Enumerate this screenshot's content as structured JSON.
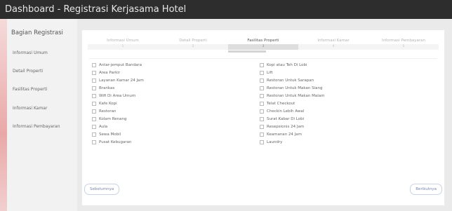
{
  "app": {
    "title": "Dashboard - Registrasi Kerjasama Hotel"
  },
  "colors": {
    "topbar": "#2d2d2d",
    "accent": "#e9a8a8",
    "panel": "#ffffff"
  },
  "sidebar": {
    "title": "Bagian Registrasi",
    "items": [
      {
        "label": "Informasi Umum"
      },
      {
        "label": "Detail Properti"
      },
      {
        "label": "Fasilitas Properti"
      },
      {
        "label": "Informasi Kamar"
      },
      {
        "label": "Informasi Pembayaran"
      }
    ]
  },
  "tabs": [
    {
      "label": "Informasi Umum",
      "number": "1",
      "active": false
    },
    {
      "label": "Detail Properti",
      "number": "2",
      "active": false
    },
    {
      "label": "Fasilitas Properti",
      "number": "3",
      "active": true
    },
    {
      "label": "Informasi Kamar",
      "number": "4",
      "active": false
    },
    {
      "label": "Informasi Pembayaran",
      "number": "5",
      "active": false
    }
  ],
  "facilities": {
    "left": [
      {
        "label": "Antar-jemput Bandara",
        "checked": false
      },
      {
        "label": "Area Parkir",
        "checked": false
      },
      {
        "label": "Layanan Kamar 24 Jam",
        "checked": false
      },
      {
        "label": "Brankas",
        "checked": false
      },
      {
        "label": "Wifi Di Area Umum",
        "checked": false
      },
      {
        "label": "Kafe Kopi",
        "checked": false
      },
      {
        "label": "Restoran",
        "checked": false
      },
      {
        "label": "Kolam Renang",
        "checked": false
      },
      {
        "label": "Aula",
        "checked": false
      },
      {
        "label": "Sewa Mobil",
        "checked": false
      },
      {
        "label": "Pusat Kebugaran",
        "checked": false
      }
    ],
    "right": [
      {
        "label": "Kopi atau Teh Di Lobi",
        "checked": false
      },
      {
        "label": "Lift",
        "checked": false
      },
      {
        "label": "Restoran Untuk Sarapan",
        "checked": false
      },
      {
        "label": "Restoran Untuk Makan Siang",
        "checked": false
      },
      {
        "label": "Restoran Untuk Makan Malam",
        "checked": false
      },
      {
        "label": "Telat Checkout",
        "checked": false
      },
      {
        "label": "Checkin Lebih Awal",
        "checked": false
      },
      {
        "label": "Surat Kabar Di Lobi",
        "checked": false
      },
      {
        "label": "Resepsionis 24 Jam",
        "checked": false
      },
      {
        "label": "Keamanan 24 Jam",
        "checked": false
      },
      {
        "label": "Laundry",
        "checked": false
      }
    ]
  },
  "nav": {
    "prev_label": "Sebelumnya",
    "next_label": "Berikutnya"
  }
}
